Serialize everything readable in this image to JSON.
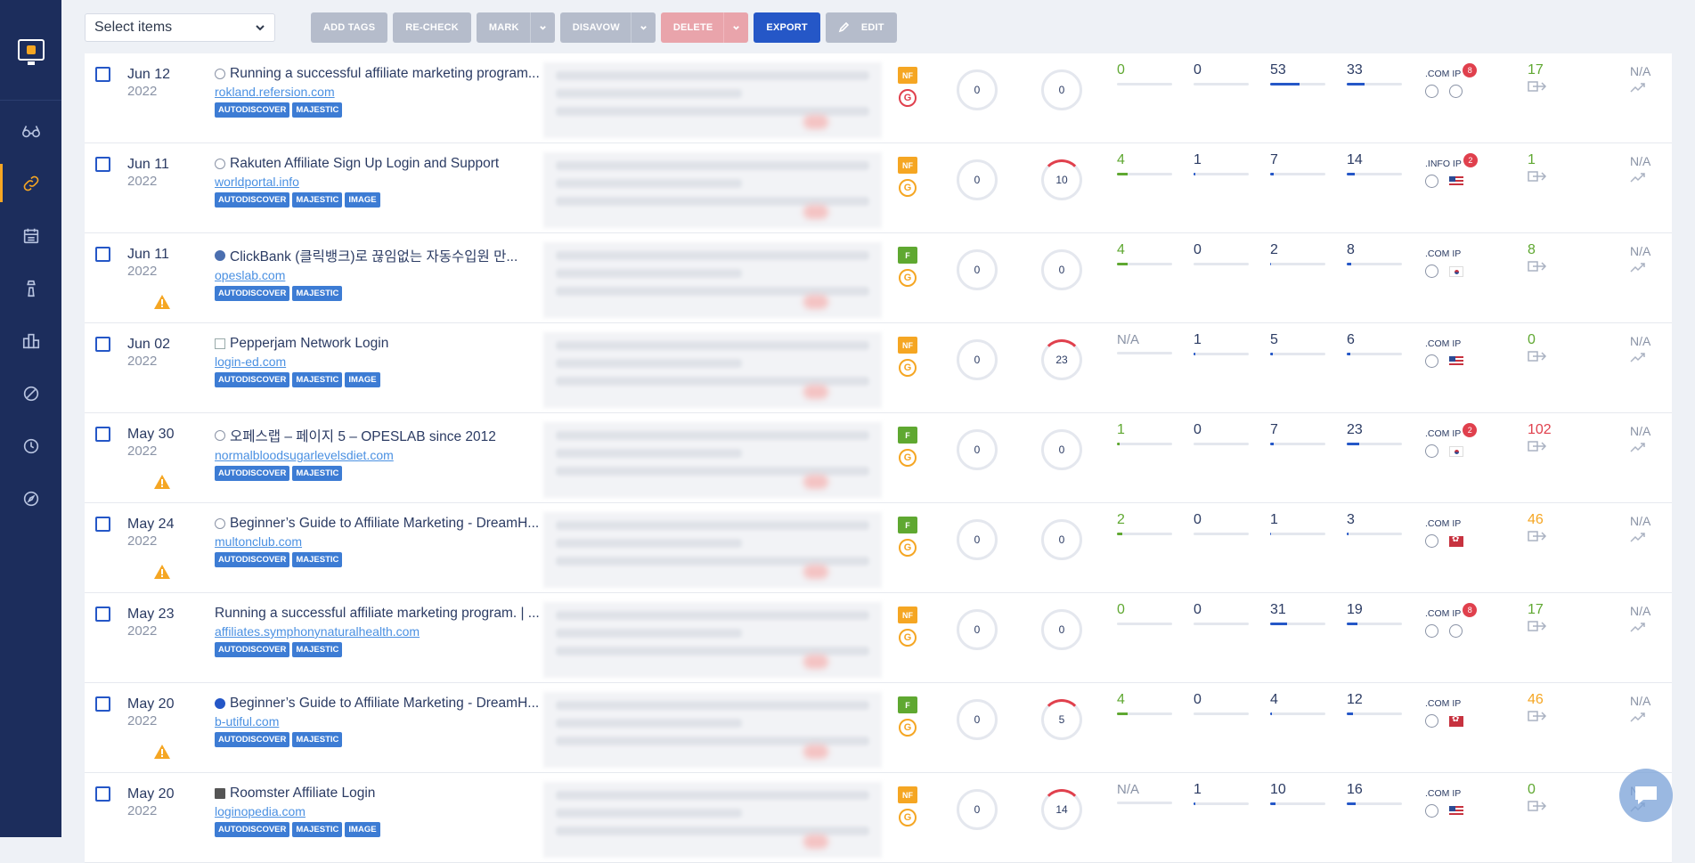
{
  "toolbar": {
    "select_label": "Select items",
    "add_tags": "ADD TAGS",
    "recheck": "RE-CHECK",
    "mark": "MARK",
    "disavow": "DISAVOW",
    "delete": "DELETE",
    "export": "EXPORT",
    "edit": "EDIT"
  },
  "sidebar": {
    "items": [
      "view-icon",
      "link-icon",
      "calendar-icon",
      "tower-icon",
      "buildings-icon",
      "disavow-icon",
      "clock-icon",
      "compass-icon"
    ],
    "active": "link-icon"
  },
  "colors": {
    "accent": "#f5a623",
    "primary": "#2557c7",
    "sidebar": "#1c2d5c"
  },
  "rows": [
    {
      "date": "Jun 12",
      "year": "2022",
      "warn": false,
      "fav": "globe",
      "title": "Running a successful affiliate marketing program...",
      "url": "rokland.refersion.com",
      "tags": [
        "AUTODISCOVER",
        "MAJESTIC"
      ],
      "follow": "NF",
      "g": "red",
      "r1": "0",
      "r2": "0",
      "m1": "0",
      "m1g": true,
      "m2": "0",
      "m3": "53",
      "m4": "33",
      "ip": ".COM IP",
      "ipcnt": "8",
      "flag": "globe",
      "out": "17",
      "outc": "green",
      "trend": "N/A"
    },
    {
      "date": "Jun 11",
      "year": "2022",
      "warn": false,
      "fav": "globe",
      "title": "Rakuten Affiliate Sign Up Login and Support",
      "url": "worldportal.info",
      "tags": [
        "AUTODISCOVER",
        "MAJESTIC",
        "IMAGE"
      ],
      "follow": "NF",
      "g": "org",
      "r1": "0",
      "r2": "10",
      "m1": "4",
      "m1g": true,
      "m2": "1",
      "m3": "7",
      "m4": "14",
      "ip": ".INFO IP",
      "ipcnt": "2",
      "flag": "us",
      "out": "1",
      "outc": "green",
      "trend": "N/A"
    },
    {
      "date": "Jun 11",
      "year": "2022",
      "warn": true,
      "fav": "wp",
      "title": "ClickBank (클릭뱅크)로 끊임없는 자동수입원 만...",
      "url": "opeslab.com",
      "tags": [
        "AUTODISCOVER",
        "MAJESTIC"
      ],
      "follow": "F",
      "g": "org",
      "r1": "0",
      "r2": "0",
      "m1": "4",
      "m1g": true,
      "m2": "0",
      "m3": "2",
      "m4": "8",
      "ip": ".COM IP",
      "ipcnt": "",
      "flag": "kr",
      "out": "8",
      "outc": "green",
      "trend": "N/A"
    },
    {
      "date": "Jun 02",
      "year": "2022",
      "warn": false,
      "fav": "img",
      "title": "Pepperjam Network Login",
      "url": "login-ed.com",
      "tags": [
        "AUTODISCOVER",
        "MAJESTIC",
        "IMAGE"
      ],
      "follow": "NF",
      "g": "org",
      "r1": "0",
      "r2": "23",
      "m1": "N/A",
      "m1g": false,
      "m2": "1",
      "m3": "5",
      "m4": "6",
      "ip": ".COM IP",
      "ipcnt": "",
      "flag": "us",
      "out": "0",
      "outc": "green",
      "trend": "N/A"
    },
    {
      "date": "May 30",
      "year": "2022",
      "warn": true,
      "fav": "globe",
      "title": "오페스랩 – 페이지 5 – OPESLAB since 2012",
      "url": "normalbloodsugarlevelsdiet.com",
      "tags": [
        "AUTODISCOVER",
        "MAJESTIC"
      ],
      "follow": "F",
      "g": "org",
      "r1": "0",
      "r2": "0",
      "m1": "1",
      "m1g": true,
      "m2": "0",
      "m3": "7",
      "m4": "23",
      "ip": ".COM IP",
      "ipcnt": "2",
      "flag": "kr",
      "out": "102",
      "outc": "red",
      "trend": "N/A"
    },
    {
      "date": "May 24",
      "year": "2022",
      "warn": true,
      "fav": "globe",
      "title": "Beginner’s Guide to Affiliate Marketing - DreamH...",
      "url": "multonclub.com",
      "tags": [
        "AUTODISCOVER",
        "MAJESTIC"
      ],
      "follow": "F",
      "g": "org",
      "r1": "0",
      "r2": "0",
      "m1": "2",
      "m1g": true,
      "m2": "0",
      "m3": "1",
      "m4": "3",
      "ip": ".COM IP",
      "ipcnt": "",
      "flag": "hk",
      "out": "46",
      "outc": "orange",
      "trend": "N/A"
    },
    {
      "date": "May 23",
      "year": "2022",
      "warn": false,
      "fav": "none",
      "title": "Running a successful affiliate marketing program. | ...",
      "url": "affiliates.symphonynaturalhealth.com",
      "tags": [
        "AUTODISCOVER",
        "MAJESTIC"
      ],
      "follow": "NF",
      "g": "org",
      "r1": "0",
      "r2": "0",
      "m1": "0",
      "m1g": true,
      "m2": "0",
      "m3": "31",
      "m4": "19",
      "ip": ".COM IP",
      "ipcnt": "8",
      "flag": "globe",
      "out": "17",
      "outc": "green",
      "trend": "N/A"
    },
    {
      "date": "May 20",
      "year": "2022",
      "warn": true,
      "fav": "blue",
      "title": "Beginner’s Guide to Affiliate Marketing - DreamH...",
      "url": "b-utiful.com",
      "tags": [
        "AUTODISCOVER",
        "MAJESTIC"
      ],
      "follow": "F",
      "g": "org",
      "r1": "0",
      "r2": "5",
      "m1": "4",
      "m1g": true,
      "m2": "0",
      "m3": "4",
      "m4": "12",
      "ip": ".COM IP",
      "ipcnt": "",
      "flag": "hk",
      "out": "46",
      "outc": "orange",
      "trend": "N/A"
    },
    {
      "date": "May 20",
      "year": "2022",
      "warn": false,
      "fav": "stack",
      "title": "Roomster Affiliate Login",
      "url": "loginopedia.com",
      "tags": [
        "AUTODISCOVER",
        "MAJESTIC",
        "IMAGE"
      ],
      "follow": "NF",
      "g": "org",
      "r1": "0",
      "r2": "14",
      "m1": "N/A",
      "m1g": false,
      "m2": "1",
      "m3": "10",
      "m4": "16",
      "ip": ".COM IP",
      "ipcnt": "",
      "flag": "us",
      "out": "0",
      "outc": "green",
      "trend": "N/A"
    }
  ]
}
